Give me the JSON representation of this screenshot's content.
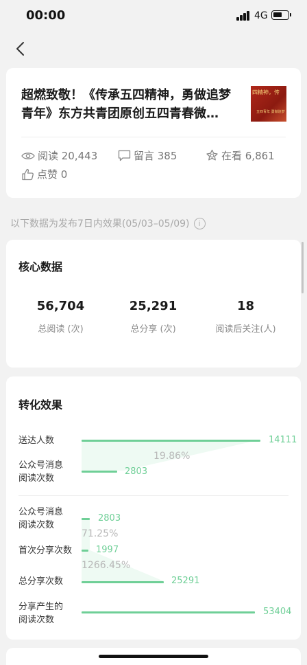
{
  "status_bar": {
    "time": "00:00",
    "network": "4G"
  },
  "article": {
    "title": "超燃致敬！《传承五四精神，勇做追梦青年》东方共青团原创五四青春微…",
    "thumbnail_text": "四精神，传",
    "thumbnail_subtext": "五四青年 勇做追梦",
    "stats": {
      "read": "阅读 20,443",
      "comments": "留言 385",
      "watching": "在看 6,861",
      "likes": "点赞 0"
    }
  },
  "period_note": "以下数据为发布7日内效果(05/03–05/09)",
  "core": {
    "title": "核心数据",
    "metrics": [
      {
        "value": "56,704",
        "label": "总阅读 (次)"
      },
      {
        "value": "25,291",
        "label": "总分享 (次)"
      },
      {
        "value": "18",
        "label": "阅读后关注(人)"
      }
    ]
  },
  "conversion": {
    "title": "转化效果",
    "group1": {
      "rows": [
        {
          "label": "送达人数",
          "value": "14111"
        },
        {
          "label": "公众号消息\n阅读次数",
          "value": "2803"
        }
      ],
      "rate": "19.86%"
    },
    "group2": {
      "rows": [
        {
          "label": "公众号消息\n阅读次数",
          "value": "2803"
        },
        {
          "label": "首次分享次数",
          "value": "1997"
        },
        {
          "label": "总分享次数",
          "value": "25291"
        },
        {
          "label": "分享产生的\n阅读次数",
          "value": "53404"
        }
      ],
      "rates": [
        "71.25%",
        "1266.45%"
      ]
    }
  },
  "colors": {
    "accent": "#6fcf97",
    "muted": "#b8b8b8",
    "background": "#f2f2f2"
  },
  "icons": [
    "back-chevron-icon",
    "eye-icon",
    "comment-icon",
    "watching-icon",
    "thumbs-up-icon",
    "info-icon"
  ]
}
